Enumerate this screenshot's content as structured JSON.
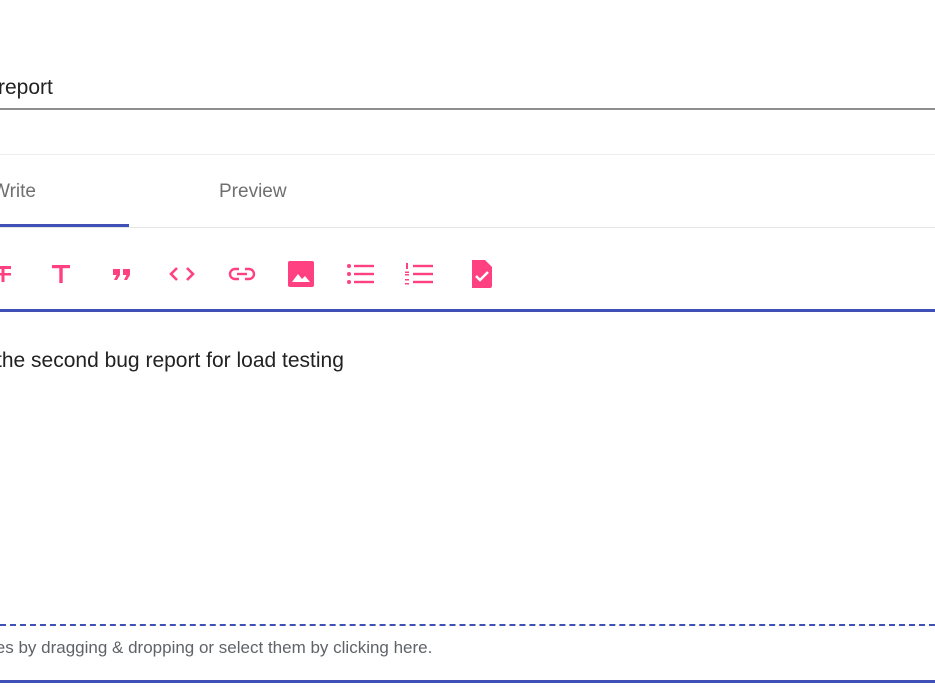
{
  "title_field": {
    "value": "report"
  },
  "tabs": [
    {
      "label": "Write",
      "active": true
    },
    {
      "label": "Preview",
      "active": false
    }
  ],
  "toolbar": {
    "icon_color": "#ff4081",
    "buttons": [
      {
        "icon": "strikethrough-icon"
      },
      {
        "icon": "heading-icon"
      },
      {
        "icon": "quote-icon"
      },
      {
        "icon": "code-icon"
      },
      {
        "icon": "link-icon"
      },
      {
        "icon": "image-icon"
      },
      {
        "icon": "bulleted-list-icon"
      },
      {
        "icon": "numbered-list-icon"
      },
      {
        "icon": "task-list-icon"
      }
    ]
  },
  "editor": {
    "text": " the second bug report for load testing"
  },
  "dropzone": {
    "text": "les by dragging & dropping or select them by clicking here."
  },
  "colors": {
    "accent": "#3f51b5",
    "icon": "#ff4081"
  }
}
